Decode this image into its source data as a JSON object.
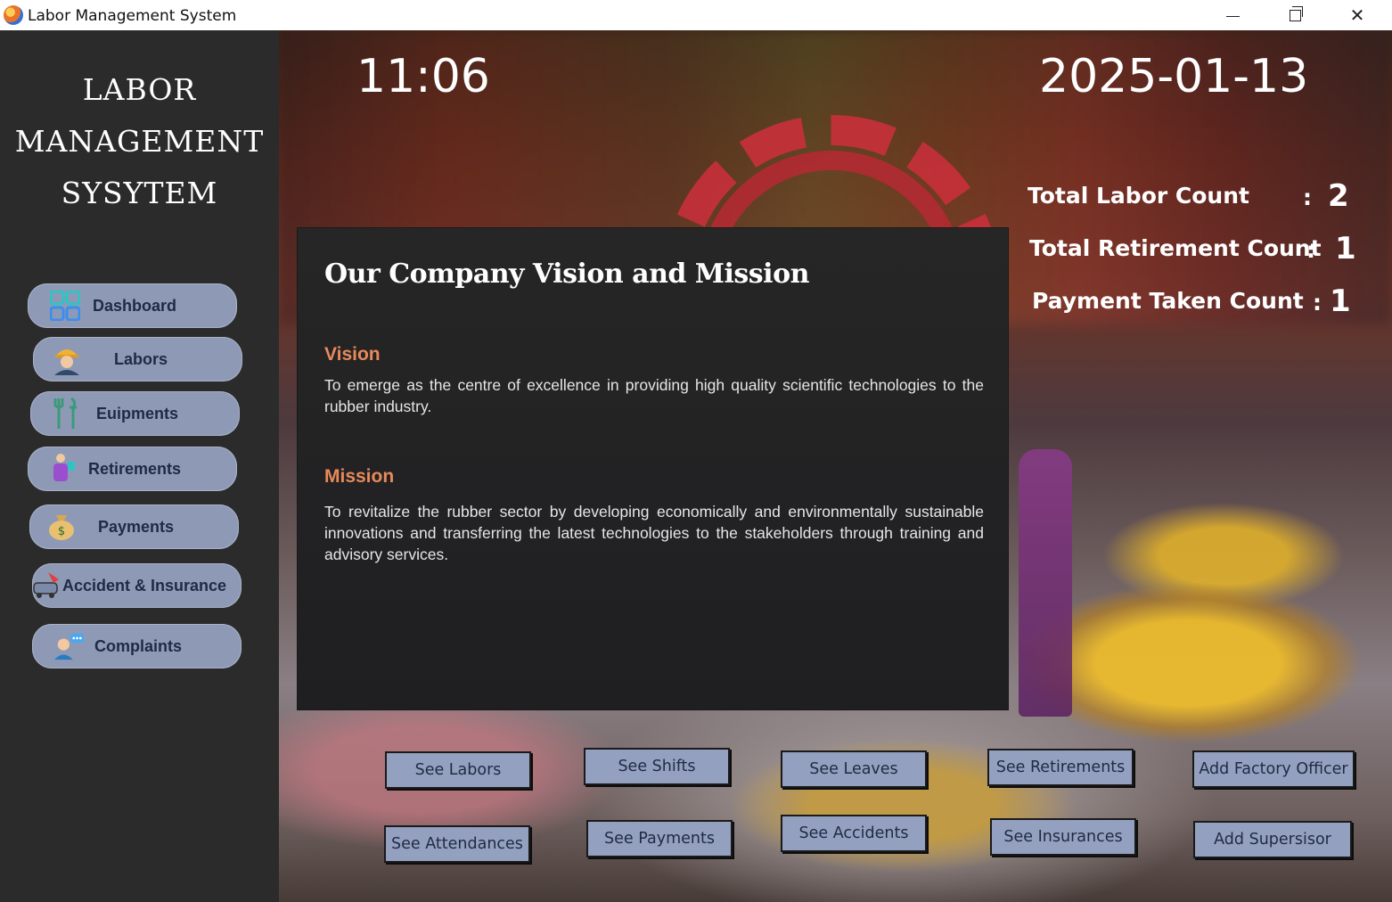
{
  "window": {
    "title": "Labor Management System"
  },
  "sidebar": {
    "brand": [
      "LABOR",
      "MANAGEMENT",
      "SYSYTEM"
    ],
    "items": [
      {
        "label": "Dashboard",
        "icon": "dashboard-icon"
      },
      {
        "label": "Labors",
        "icon": "worker-icon"
      },
      {
        "label": "Euipments",
        "icon": "tools-icon"
      },
      {
        "label": "Retirements",
        "icon": "retirement-icon"
      },
      {
        "label": "Payments",
        "icon": "money-bag-icon"
      },
      {
        "label": "Accident & Insurance",
        "icon": "accident-icon"
      },
      {
        "label": "Complaints",
        "icon": "complaint-icon"
      }
    ]
  },
  "header": {
    "time": "11:06",
    "date": "2025-01-13"
  },
  "stats": [
    {
      "label": "Total Labor Count",
      "value": "2"
    },
    {
      "label": "Total Retirement Count",
      "value": "1"
    },
    {
      "label": "Payment Taken Count",
      "value": "1"
    }
  ],
  "panel": {
    "title": "Our Company Vision and Mission",
    "vision_heading": "Vision",
    "vision_text": "To emerge as the centre of excellence in providing high quality scientific technologies to the rubber industry.",
    "mission_heading": "Mission",
    "mission_text": "To revitalize the rubber sector by developing economically and environmentally sustainable innovations and transferring the latest technologies to the stakeholders through training and advisory services."
  },
  "actions": {
    "row1": [
      "See Labors",
      "See Shifts",
      "See Leaves",
      "See Retirements",
      "Add Factory Officer"
    ],
    "row2": [
      "See Attendances",
      "See Payments",
      "See Accidents",
      "See Insurances",
      "Add Supersisor"
    ]
  },
  "colors": {
    "sidebar": "#2b2b2b",
    "nav_button": "#8e9ab5",
    "accent_heading": "#e8895a",
    "action_button": "#94a0bf"
  }
}
